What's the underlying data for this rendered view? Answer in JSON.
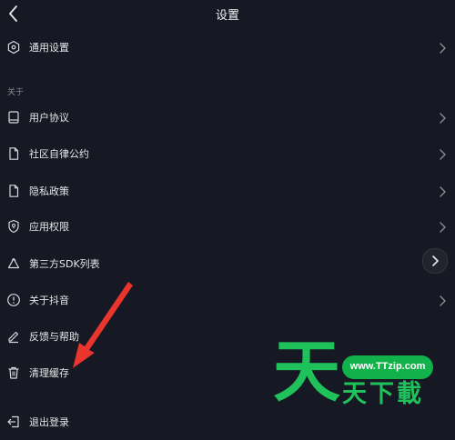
{
  "header": {
    "title": "设置",
    "back_icon": "chevron-left-icon"
  },
  "general": {
    "label": "通用设置",
    "icon": "hexagon-settings-icon"
  },
  "about_section": {
    "title": "关于",
    "items": [
      {
        "label": "用户协议",
        "icon": "book-icon"
      },
      {
        "label": "社区自律公约",
        "icon": "document-icon"
      },
      {
        "label": "隐私政策",
        "icon": "document-icon"
      },
      {
        "label": "应用权限",
        "icon": "shield-icon"
      },
      {
        "label": "第三方SDK列表",
        "icon": "recycle-icon"
      },
      {
        "label": "关于抖音",
        "icon": "info-icon"
      },
      {
        "label": "反馈与帮助",
        "icon": "edit-icon"
      },
      {
        "label": "清理缓存",
        "icon": "trash-icon"
      }
    ]
  },
  "logout": {
    "label": "退出登录",
    "icon": "logout-icon"
  },
  "watermark": {
    "url": "www.TTzip.com",
    "big_char": "天",
    "small_text": "天下載"
  },
  "colors": {
    "background": "#161823",
    "text": "#e6e6e9",
    "muted": "#8a8b91",
    "arrow_red": "#e8352e",
    "watermark_green": "#1fc25a"
  }
}
